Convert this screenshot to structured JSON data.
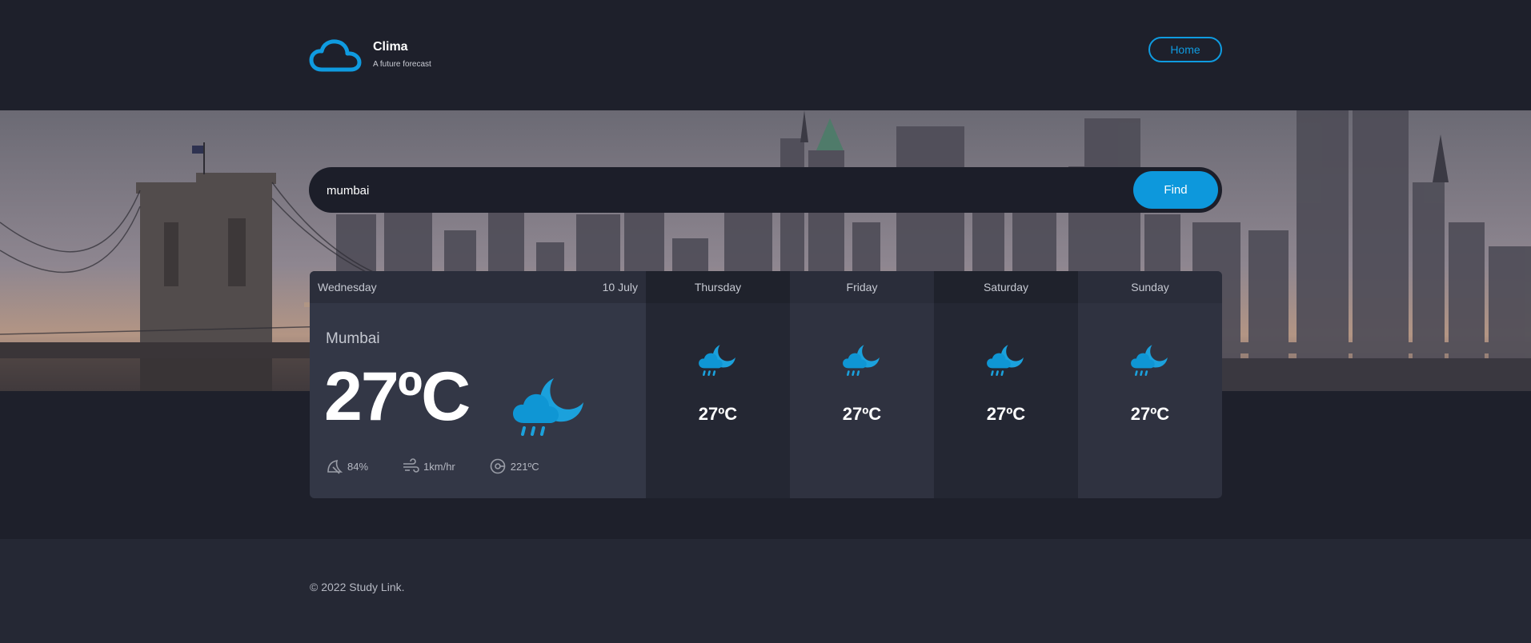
{
  "brand": {
    "name": "Clima",
    "tagline": "A future forecast",
    "logo_icon": "cloud-icon",
    "accent": "#0f9be0"
  },
  "nav": {
    "home_label": "Home"
  },
  "search": {
    "value": "mumbai",
    "button_label": "Find"
  },
  "today": {
    "day": "Wednesday",
    "date": "10 July",
    "city": "Mumbai",
    "temperature": "27ºC",
    "icon": "moon-rain-icon",
    "humidity": "84%",
    "wind": "1km/hr",
    "direction": "221ºC"
  },
  "forecast": [
    {
      "day": "Thursday",
      "temperature": "27ºC",
      "icon": "moon-rain-icon"
    },
    {
      "day": "Friday",
      "temperature": "27ºC",
      "icon": "moon-rain-icon"
    },
    {
      "day": "Saturday",
      "temperature": "27ºC",
      "icon": "moon-rain-icon"
    },
    {
      "day": "Sunday",
      "temperature": "27ºC",
      "icon": "moon-rain-icon"
    }
  ],
  "footer": {
    "copyright": "© 2022 Study Link."
  }
}
